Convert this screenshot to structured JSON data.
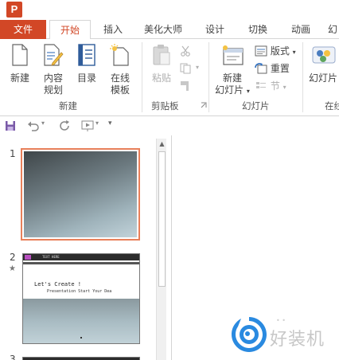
{
  "app": {
    "icon_letter": "P"
  },
  "tabs": [
    {
      "label": "文件"
    },
    {
      "label": "开始"
    },
    {
      "label": "插入"
    },
    {
      "label": "美化大师"
    },
    {
      "label": "设计"
    },
    {
      "label": "切换"
    },
    {
      "label": "动画"
    },
    {
      "label": "幻"
    }
  ],
  "ribbon": {
    "new_group": {
      "label": "新建",
      "buttons": [
        {
          "label": "新建"
        },
        {
          "label": "内容",
          "label2": "规划"
        },
        {
          "label": "目录"
        },
        {
          "label": "在线",
          "label2": "模板"
        }
      ]
    },
    "clipboard_group": {
      "label": "剪贴板",
      "paste_label": "粘贴"
    },
    "slides_group": {
      "label": "幻灯片",
      "new_slide_label": "新建",
      "new_slide_label2": "幻灯片",
      "layout_label": "版式",
      "reset_label": "重置",
      "section_label": "节"
    },
    "next_group": {
      "label": "在线",
      "slide_label": "幻灯片"
    }
  },
  "slides": [
    {
      "number": "1",
      "selected": true
    },
    {
      "number": "2",
      "starred": true,
      "title_text": "Let's Create !",
      "subtitle_text": "Presentation  Start Your Dea",
      "header_text": "TEXT HERE"
    },
    {
      "number": "3"
    }
  ],
  "watermark": {
    "text": "好装机"
  },
  "colors": {
    "accent": "#d24726",
    "selected_border": "#e8805a"
  }
}
